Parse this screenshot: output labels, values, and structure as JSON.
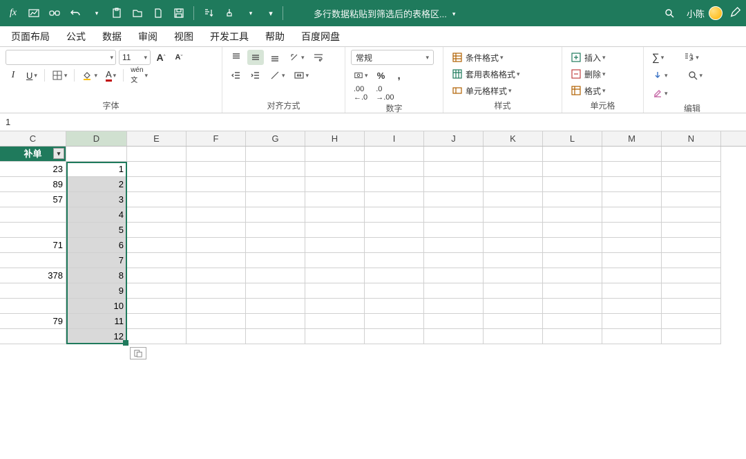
{
  "titlebar": {
    "doc_title": "多行数据粘贴到筛选后的表格区...",
    "user_name": "小陈"
  },
  "tabs": [
    "页面布局",
    "公式",
    "数据",
    "审阅",
    "视图",
    "开发工具",
    "帮助",
    "百度网盘"
  ],
  "ribbon": {
    "font": {
      "size_value": "11",
      "group_label": "字体"
    },
    "alignment": {
      "group_label": "对齐方式"
    },
    "number": {
      "format_value": "常规",
      "group_label": "数字"
    },
    "styles": {
      "conditional": "条件格式",
      "table": "套用表格格式",
      "cell": "单元格样式",
      "group_label": "样式"
    },
    "cells": {
      "insert": "插入",
      "delete": "删除",
      "format": "格式",
      "group_label": "单元格"
    },
    "editing": {
      "group_label": "编辑"
    }
  },
  "formula_bar": {
    "value": "1"
  },
  "columns": [
    "C",
    "D",
    "E",
    "F",
    "G",
    "H",
    "I",
    "J",
    "K",
    "L",
    "M",
    "N"
  ],
  "header_cell_C": "补单",
  "colC_values": [
    "23",
    "89",
    "57",
    "",
    "",
    "71",
    "",
    "378",
    "",
    "",
    "79",
    ""
  ],
  "colD_values": [
    "1",
    "2",
    "3",
    "4",
    "5",
    "6",
    "7",
    "8",
    "9",
    "10",
    "11",
    "12"
  ]
}
